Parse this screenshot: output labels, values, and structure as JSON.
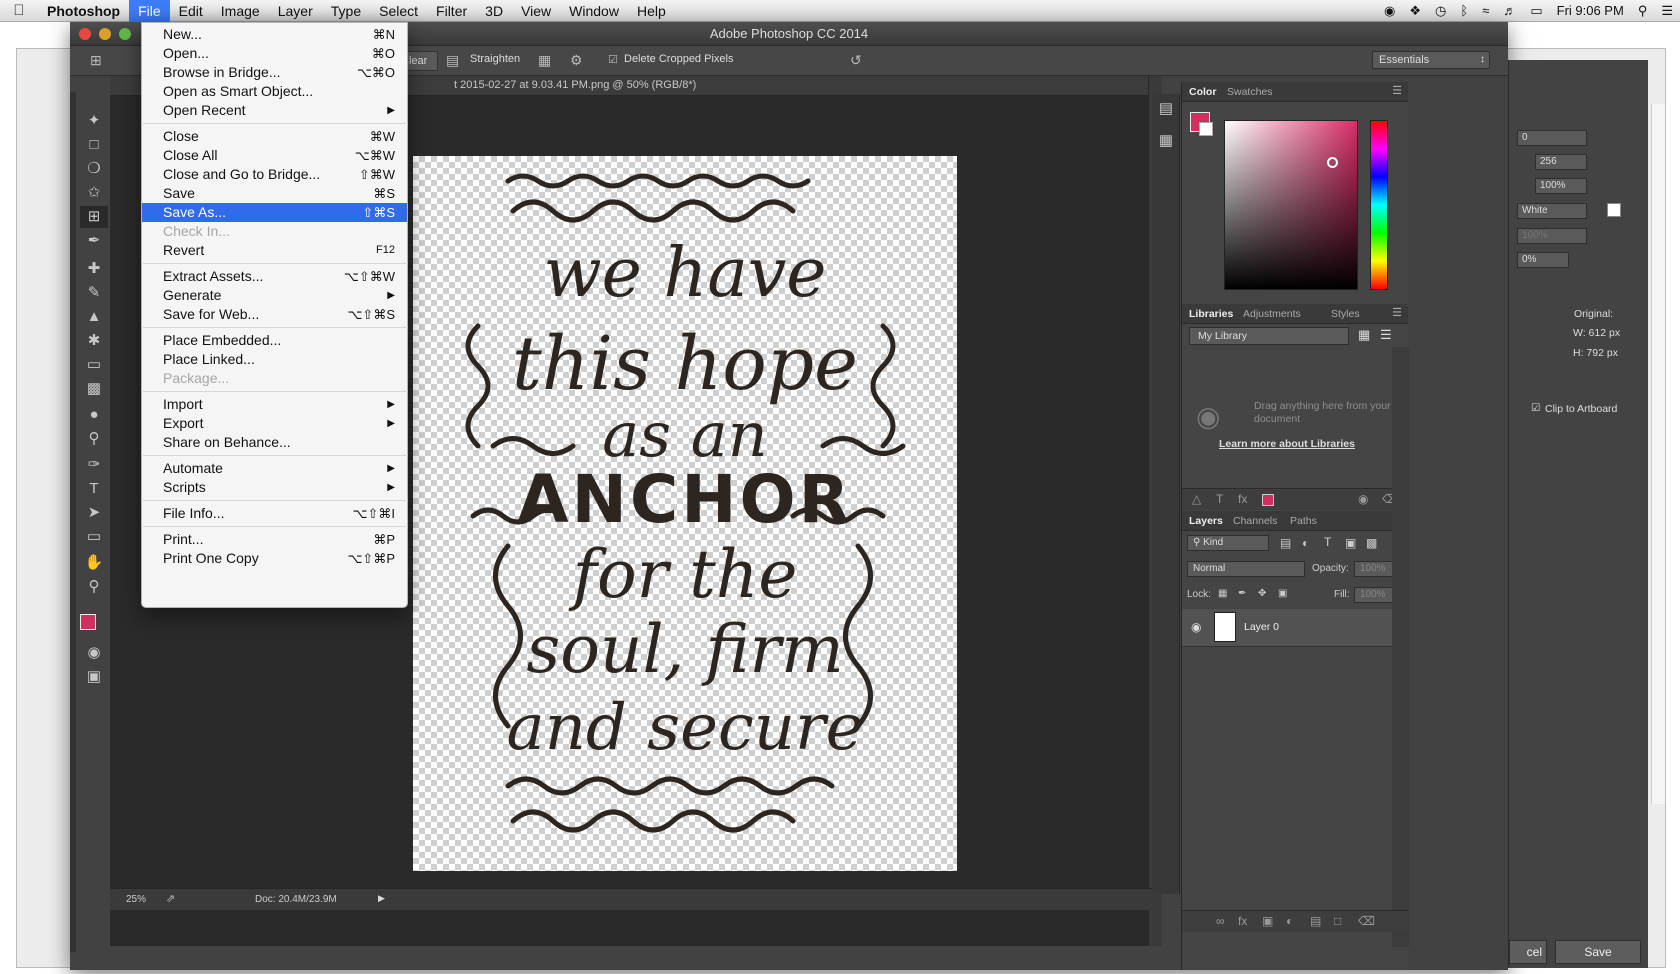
{
  "menubar": {
    "app": "Photoshop",
    "items": [
      "File",
      "Edit",
      "Image",
      "Layer",
      "Type",
      "Select",
      "Filter",
      "3D",
      "View",
      "Window",
      "Help"
    ],
    "clock": "Fri 9:06 PM"
  },
  "window": {
    "title": "Adobe Photoshop CC 2014",
    "doc_tab": "t 2015-02-27 at 9.03.41 PM.png @ 50% (RGB/8*)"
  },
  "options_bar": {
    "clear": "Clear",
    "straighten": "Straighten",
    "delete_cropped": "Delete Cropped Pixels",
    "workspace": "Essentials"
  },
  "file_menu": {
    "items": [
      {
        "label": "New...",
        "shortcut": "⌘N"
      },
      {
        "label": "Open...",
        "shortcut": "⌘O"
      },
      {
        "label": "Browse in Bridge...",
        "shortcut": "⌥⌘O"
      },
      {
        "label": "Open as Smart Object...",
        "shortcut": ""
      },
      {
        "label": "Open Recent",
        "shortcut": ""
      },
      {
        "label": "Close",
        "shortcut": "⌘W"
      },
      {
        "label": "Close All",
        "shortcut": "⌥⌘W"
      },
      {
        "label": "Close and Go to Bridge...",
        "shortcut": "⇧⌘W"
      },
      {
        "label": "Save",
        "shortcut": "⌘S"
      },
      {
        "label": "Save As...",
        "shortcut": "⇧⌘S"
      },
      {
        "label": "Check In...",
        "shortcut": ""
      },
      {
        "label": "Revert",
        "shortcut": "F12"
      },
      {
        "label": "Extract Assets...",
        "shortcut": "⌥⇧⌘W"
      },
      {
        "label": "Generate",
        "shortcut": ""
      },
      {
        "label": "Save for Web...",
        "shortcut": "⌥⇧⌘S"
      },
      {
        "label": "Place Embedded...",
        "shortcut": ""
      },
      {
        "label": "Place Linked...",
        "shortcut": ""
      },
      {
        "label": "Package...",
        "shortcut": ""
      },
      {
        "label": "Import",
        "shortcut": ""
      },
      {
        "label": "Export",
        "shortcut": ""
      },
      {
        "label": "Share on Behance...",
        "shortcut": ""
      },
      {
        "label": "Automate",
        "shortcut": ""
      },
      {
        "label": "Scripts",
        "shortcut": ""
      },
      {
        "label": "File Info...",
        "shortcut": "⌥⇧⌘I"
      },
      {
        "label": "Print...",
        "shortcut": "⌘P"
      },
      {
        "label": "Print One Copy",
        "shortcut": "⌥⇧⌘P"
      }
    ],
    "highlighted": "Save As...",
    "disabled": [
      "Check In...",
      "Package..."
    ]
  },
  "artwork": {
    "lines": [
      "we have",
      "this hope",
      "as an",
      "ANCHOR",
      "for the",
      "soul, firm",
      "and secure"
    ]
  },
  "status": {
    "zoom": "25%",
    "doc_size": "Doc: 20.4M/23.9M"
  },
  "color_panel": {
    "tabs": [
      "Color",
      "Swatches"
    ],
    "foreground": "#d0335f"
  },
  "libraries_panel": {
    "tabs": [
      "Libraries",
      "Adjustments",
      "Styles"
    ],
    "library": "My Library",
    "drag_hint": "Drag anything here from your document",
    "learn_more": "Learn more about Libraries"
  },
  "layers_panel": {
    "tabs": [
      "Layers",
      "Channels",
      "Paths"
    ],
    "filter_kind": "Kind",
    "blend_mode": "Normal",
    "opacity_label": "Opacity:",
    "opacity": "100%",
    "lock_label": "Lock:",
    "fill_label": "Fill:",
    "fill": "100%",
    "layer_name": "Layer 0"
  },
  "right_dialog": {
    "fields": [
      "0",
      "256",
      "100%",
      "White",
      "100%",
      "0%"
    ],
    "original_label": "Original:",
    "width": "W: 612 px",
    "height": "H: 792 px",
    "clip_to_artboard": "Clip to Artboard",
    "cancel": "cel",
    "save": "Save"
  }
}
